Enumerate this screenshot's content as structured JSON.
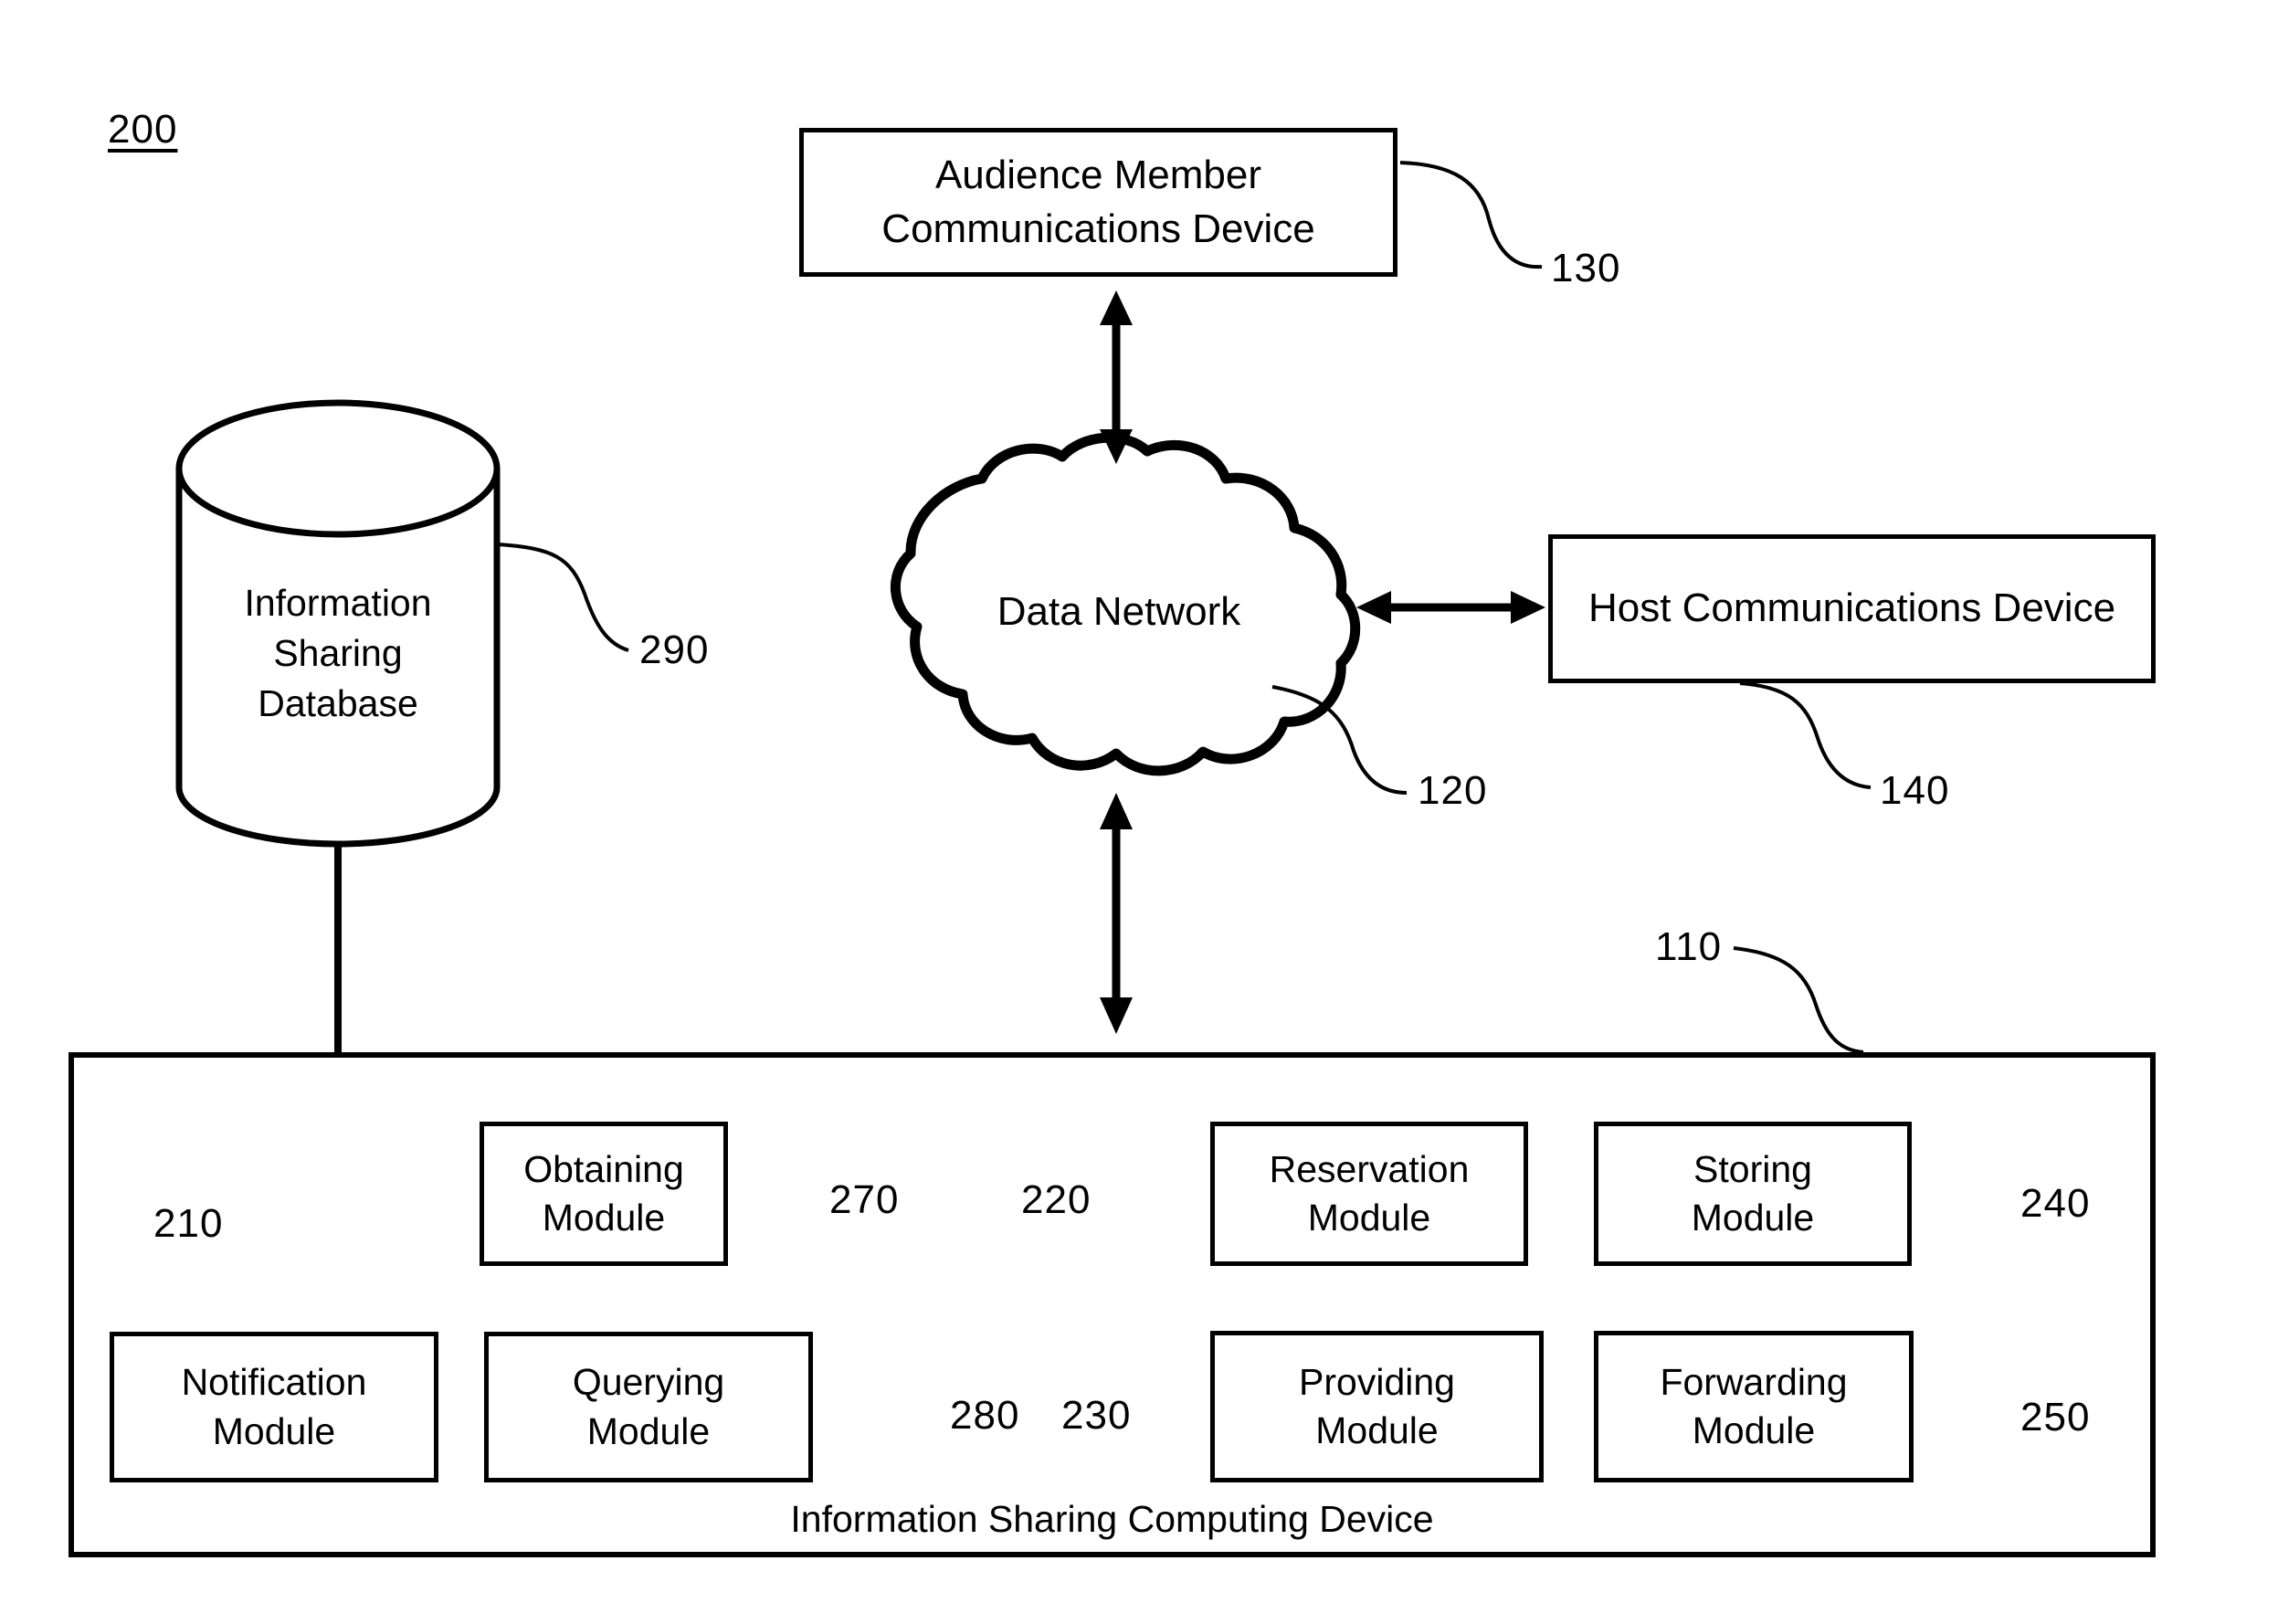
{
  "figure": {
    "number": "200"
  },
  "nodes": {
    "audience_device": {
      "line1": "Audience Member",
      "line2": "Communications Device",
      "ref": "130"
    },
    "data_network": {
      "label": "Data Network",
      "ref": "120"
    },
    "host_device": {
      "label": "Host Communications Device",
      "ref": "140"
    },
    "database": {
      "line1": "Information",
      "line2": "Sharing",
      "line3": "Database",
      "ref": "290"
    },
    "computing_device": {
      "caption": "Information Sharing Computing Device",
      "ref": "110"
    }
  },
  "modules": [
    {
      "line1": "Obtaining",
      "line2": "Module",
      "ref": "270"
    },
    {
      "line1": "Reservation",
      "line2": "Module",
      "ref": "220"
    },
    {
      "line1": "Storing",
      "line2": "Module",
      "ref": "240"
    },
    {
      "line1": "Notification",
      "line2": "Module",
      "ref": "210"
    },
    {
      "line1": "Querying",
      "line2": "Module",
      "ref": "280"
    },
    {
      "line1": "Providing",
      "line2": "Module",
      "ref": "230"
    },
    {
      "line1": "Forwarding",
      "line2": "Module",
      "ref": "250"
    }
  ],
  "connectors": [
    {
      "name": "audience-to-network",
      "type": "double-arrow",
      "orientation": "vertical"
    },
    {
      "name": "network-to-host",
      "type": "double-arrow",
      "orientation": "horizontal"
    },
    {
      "name": "network-to-computing",
      "type": "double-arrow",
      "orientation": "vertical"
    },
    {
      "name": "database-to-computing",
      "type": "plain-line",
      "orientation": "vertical"
    }
  ],
  "colors": {
    "stroke": "#000000",
    "background": "#ffffff"
  }
}
